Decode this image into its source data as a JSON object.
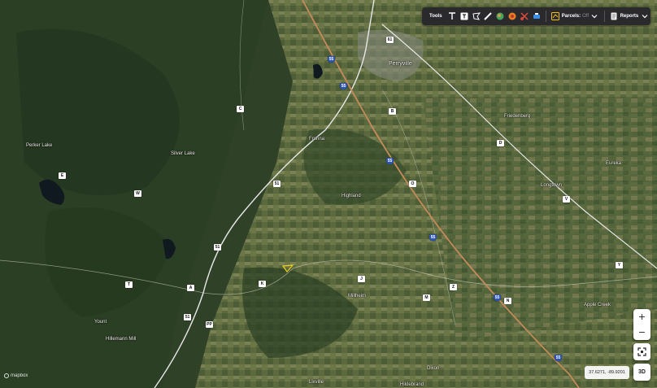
{
  "toolbar": {
    "title": "Tools",
    "parcels_label": "Parcels:",
    "parcels_state": "Off",
    "reports_label": "Reports",
    "icons": [
      "text-icon",
      "text-box-icon",
      "polygon-icon",
      "ruler-icon",
      "globe-icon",
      "circle-icon",
      "scissors-icon",
      "print-icon",
      "parcel-icon",
      "chevron-down-icon",
      "reports-icon",
      "chevron-down-icon"
    ]
  },
  "labels": {
    "perryville": "Perryville",
    "frohna": "Frohna",
    "silver_lake": "Silver Lake",
    "perker_lake": "Perker Lake",
    "highland": "Highland",
    "longtown": "Longtown",
    "friedenberg": "Friedenberg",
    "eureka": "Eureka",
    "millheim": "Millheim",
    "apple_creek": "Apple Creek",
    "wittenberg": "Hillemann Mill",
    "uniontown": "Yount",
    "altenburg": "Dixon",
    "lixville": "Lixville",
    "hildebrand": "Hildebrand"
  },
  "shields": {
    "i55": "55",
    "us61": "61",
    "h51": "51",
    "c": "C",
    "b": "B",
    "e": "E",
    "w": "W",
    "k": "K",
    "j": "J",
    "t": "T",
    "a": "A",
    "z": "Z",
    "pp": "PP",
    "o": "O",
    "v": "V",
    "ad": "D",
    "y": "Y",
    "m": "M",
    "n": "N"
  },
  "controls": {
    "zoom_in": "+",
    "zoom_out": "−",
    "three_d": "3D"
  },
  "coordinates": "37.6271, -89.9201",
  "attribution": "mapbox",
  "colors": {
    "forest": "#2f4a2a",
    "farmland": "#6b7a4a",
    "highway": "#c48a5a",
    "road": "#e8e8e8",
    "parcel_outline": "#f0d020"
  }
}
